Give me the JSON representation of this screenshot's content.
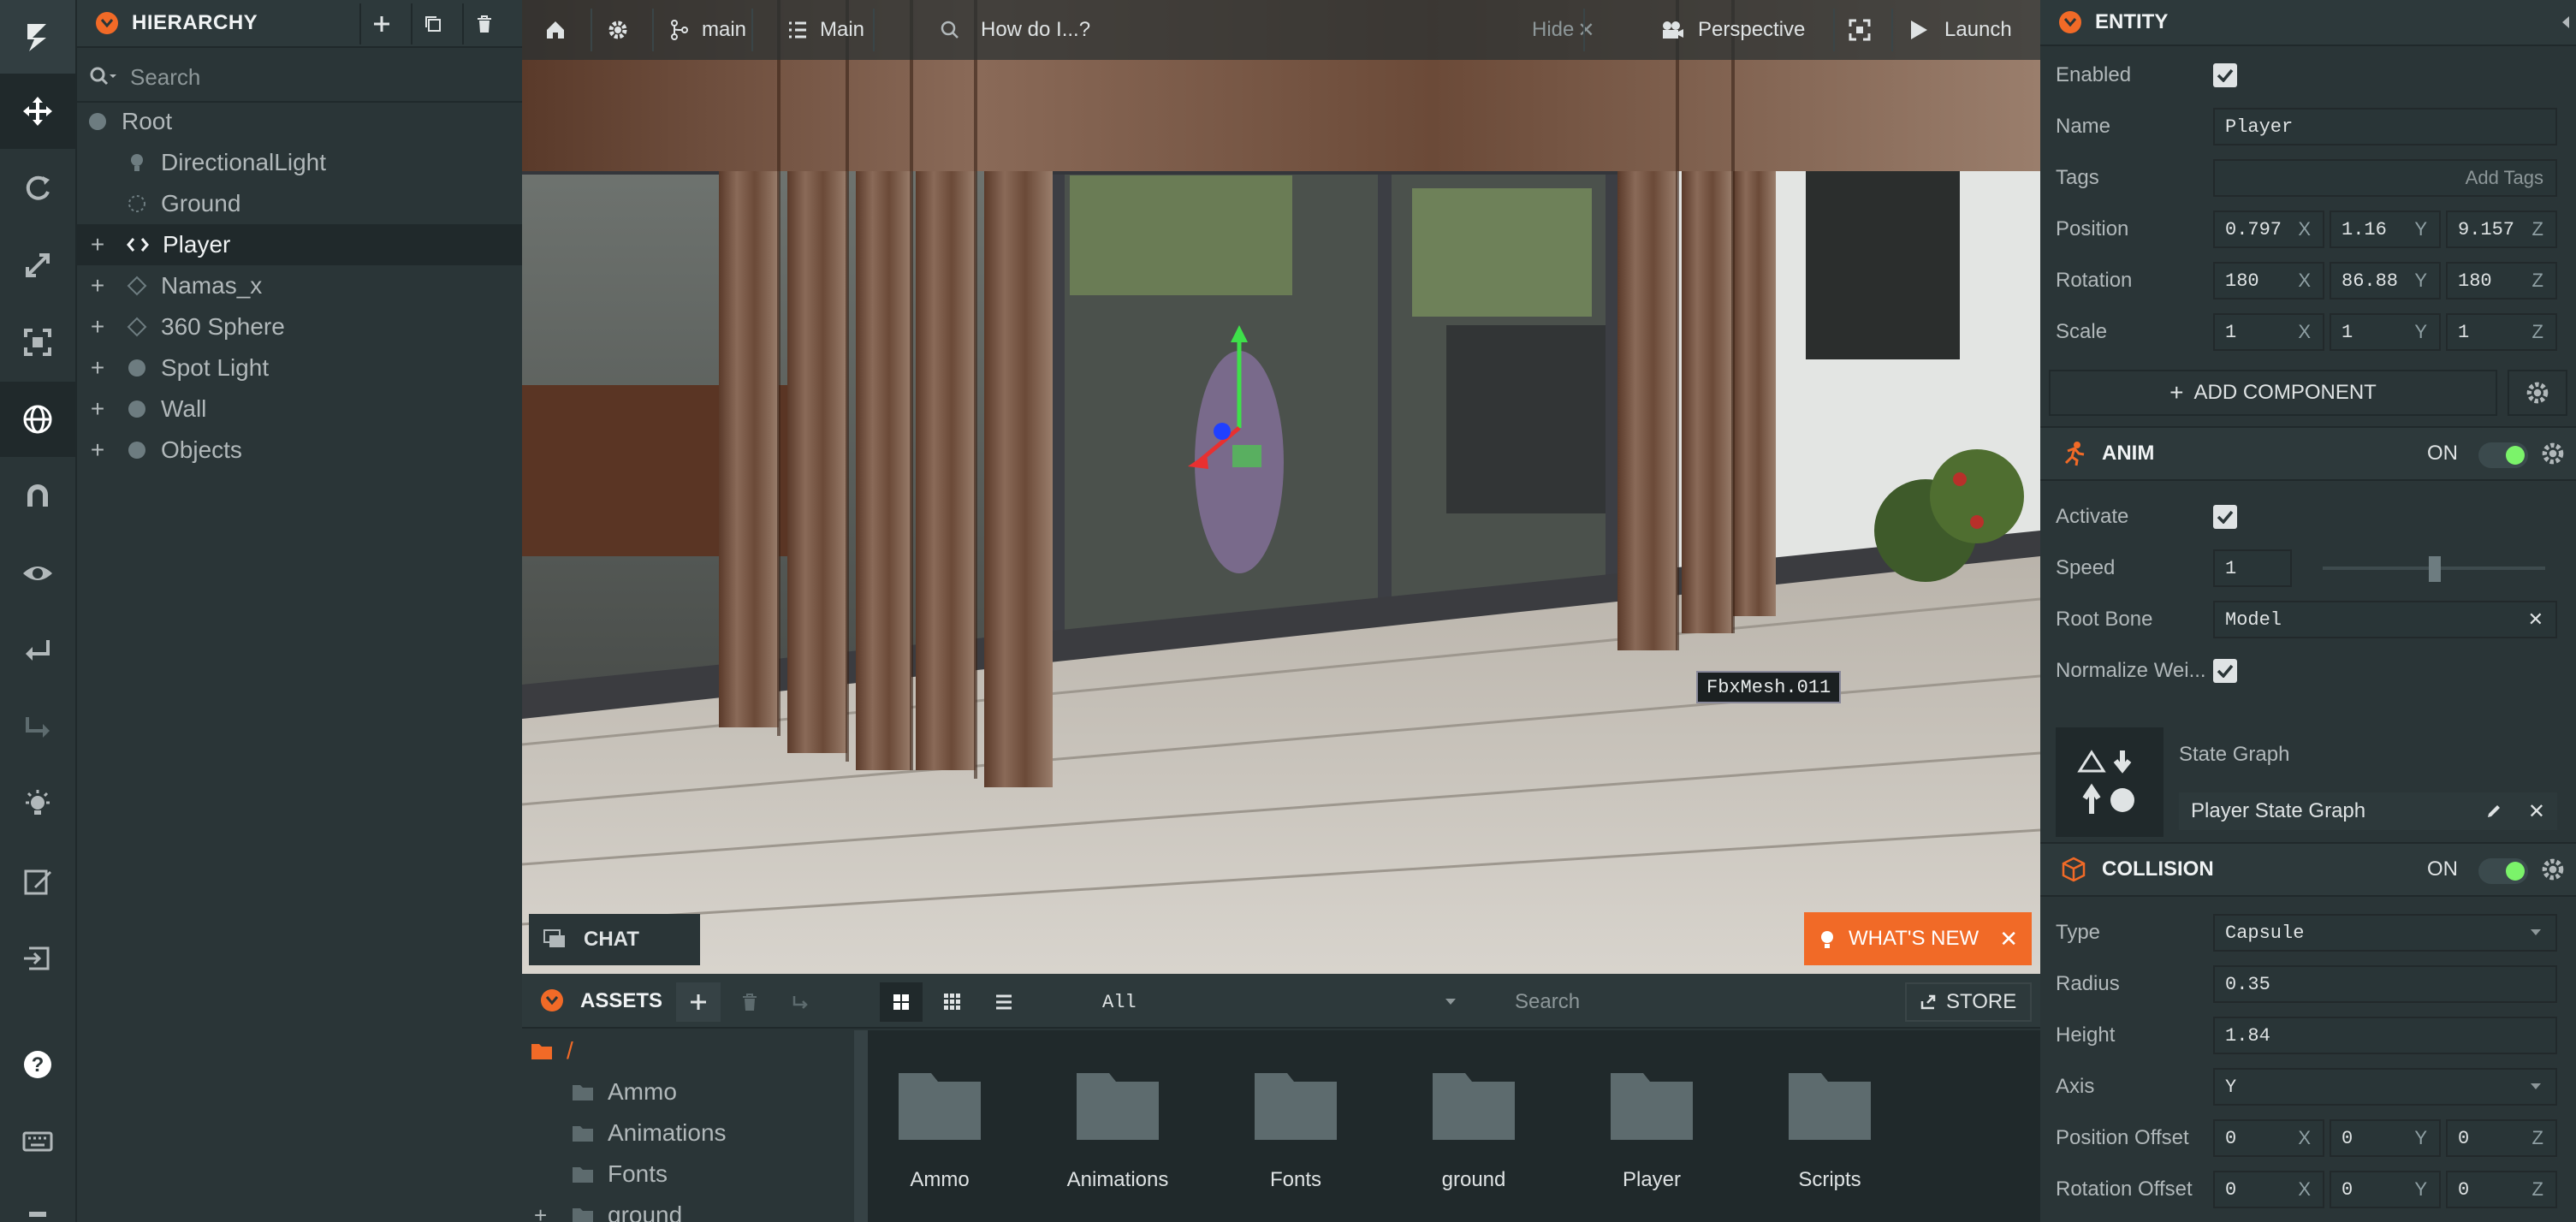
{
  "hierarchy": {
    "title": "HIERARCHY",
    "search_placeholder": "Search",
    "items": [
      {
        "label": "Root"
      },
      {
        "label": "DirectionalLight"
      },
      {
        "label": "Ground"
      },
      {
        "label": "Player"
      },
      {
        "label": "Namas_x"
      },
      {
        "label": "360 Sphere"
      },
      {
        "label": "Spot Light"
      },
      {
        "label": "Wall"
      },
      {
        "label": "Objects"
      }
    ]
  },
  "viewport_bar": {
    "branch": "main",
    "scene": "Main",
    "help_placeholder": "How do I...?",
    "hide": "Hide",
    "camera": "Perspective",
    "launch": "Launch"
  },
  "viewport": {
    "tooltip": "FbxMesh.011",
    "chat": "CHAT",
    "whats_new": "WHAT'S NEW"
  },
  "entity": {
    "title": "ENTITY",
    "enabled_label": "Enabled",
    "name_label": "Name",
    "name_value": "Player",
    "tags_label": "Tags",
    "add_tags": "Add Tags",
    "position_label": "Position",
    "position": [
      "0.797",
      "1.16",
      "9.157"
    ],
    "rotation_label": "Rotation",
    "rotation": [
      "180",
      "86.88",
      "180"
    ],
    "scale_label": "Scale",
    "scale": [
      "1",
      "1",
      "1"
    ],
    "axes": [
      "X",
      "Y",
      "Z"
    ],
    "add_component": "ADD COMPONENT"
  },
  "anim": {
    "title": "ANIM",
    "on": "ON",
    "activate_label": "Activate",
    "speed_label": "Speed",
    "speed_value": "1",
    "root_bone_label": "Root Bone",
    "root_bone_value": "Model",
    "normalize_label": "Normalize Wei...",
    "state_graph_label": "State Graph",
    "state_graph_value": "Player State Graph"
  },
  "collision": {
    "title": "COLLISION",
    "on": "ON",
    "type_label": "Type",
    "type_value": "Capsule",
    "radius_label": "Radius",
    "radius_value": "0.35",
    "height_label": "Height",
    "height_value": "1.84",
    "axis_label": "Axis",
    "axis_value": "Y",
    "pos_offset_label": "Position Offset",
    "pos_offset": [
      "0",
      "0",
      "0"
    ],
    "rot_offset_label": "Rotation Offset",
    "rot_offset": [
      "0",
      "0",
      "0"
    ]
  },
  "assets": {
    "title": "ASSETS",
    "filter": "All",
    "search_placeholder": "Search",
    "store": "STORE",
    "root": "/",
    "tree": [
      "Ammo",
      "Animations",
      "Fonts",
      "ground"
    ],
    "folders": [
      "Ammo",
      "Animations",
      "Fonts",
      "ground",
      "Player",
      "Scripts"
    ]
  },
  "colors": {
    "accent": "#f16a27",
    "panel": "#2a3537",
    "toggle_on": "#7bf36a"
  }
}
